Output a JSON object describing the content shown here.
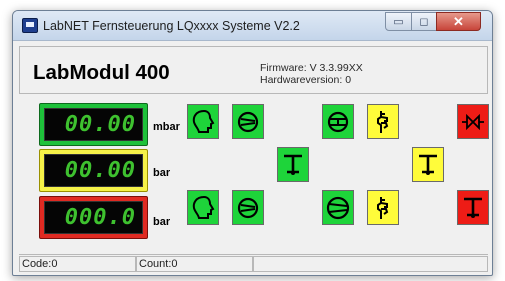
{
  "window": {
    "title": "LabNET Fernsteuerung LQxxxx Systeme V2.2",
    "controls": {
      "minimize": "▭",
      "maximize": "◻",
      "close": "✕"
    }
  },
  "header": {
    "module_name": "LabModul 400",
    "firmware": "Firmware: V 3.3.99XX",
    "hardware": "Hardwareversion: 0"
  },
  "readouts": [
    {
      "value": "00.00",
      "unit": "mbar",
      "frame": "green"
    },
    {
      "value": "00.00",
      "unit": "bar",
      "frame": "yellow"
    },
    {
      "value": "000.0",
      "unit": "bar",
      "frame": "red"
    }
  ],
  "buttons": {
    "row1": [
      "head-icon",
      "pump-icon",
      "fan-icon",
      "valve-hand-icon",
      "bowtie-valve-icon"
    ],
    "row2": [
      "t-valve-icon",
      "t-valve-icon"
    ],
    "row3": [
      "head-icon",
      "pump-icon",
      "pump-icon",
      "valve-hand-icon",
      "t-valve-icon"
    ],
    "colors": {
      "green": "#1ed43a",
      "yellow": "#fffc3a",
      "red": "#ee1c16"
    }
  },
  "status": {
    "code": "Code:0",
    "count": "Count:0"
  }
}
